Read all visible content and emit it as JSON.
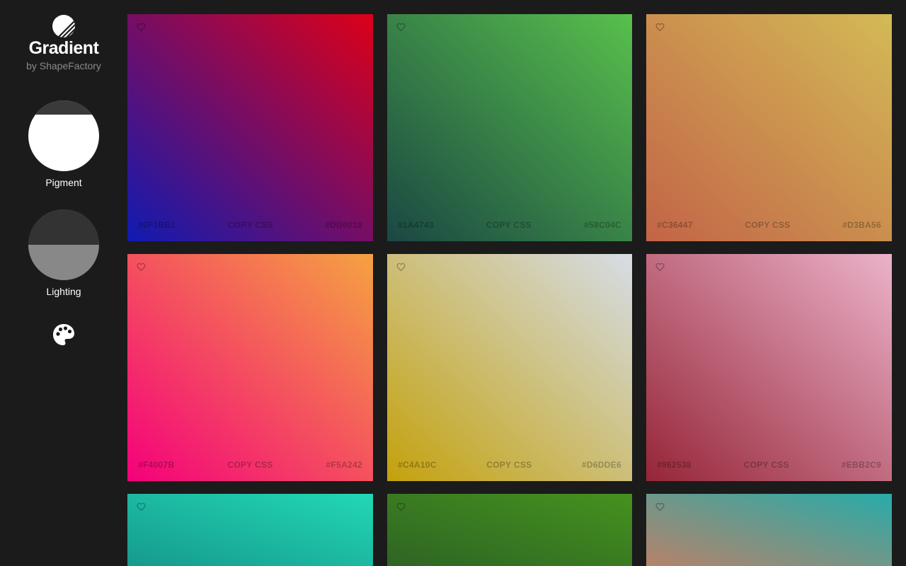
{
  "brand": {
    "title": "Gradient",
    "subtitle": "by ShapeFactory",
    "logo_icon": "diagonal-stripes-circle-icon"
  },
  "modes": [
    {
      "label": "Pigment",
      "icon": "half-filled-circle-white"
    },
    {
      "label": "Lighting",
      "icon": "half-filled-circle-gray"
    }
  ],
  "palette_icon": "palette-icon",
  "copy_label": "COPY CSS",
  "cards": [
    {
      "from": "#0F1BB1",
      "to": "#DD0018"
    },
    {
      "from": "#1A4743",
      "to": "#58C04C"
    },
    {
      "from": "#C36447",
      "to": "#D3BA56"
    },
    {
      "from": "#F4007B",
      "to": "#F5A242"
    },
    {
      "from": "#C4A10C",
      "to": "#D6DDE6"
    },
    {
      "from": "#962538",
      "to": "#EBB2C9"
    },
    {
      "from": "#169A8D",
      "to": "#22D8B4"
    },
    {
      "from": "#2E6424",
      "to": "#45921E"
    },
    {
      "from": "#B6826A",
      "to": "#27ACA9"
    }
  ],
  "colors": {
    "background": "#1b1b1b",
    "text": "#ffffff",
    "subtext": "#8a8a8a"
  }
}
